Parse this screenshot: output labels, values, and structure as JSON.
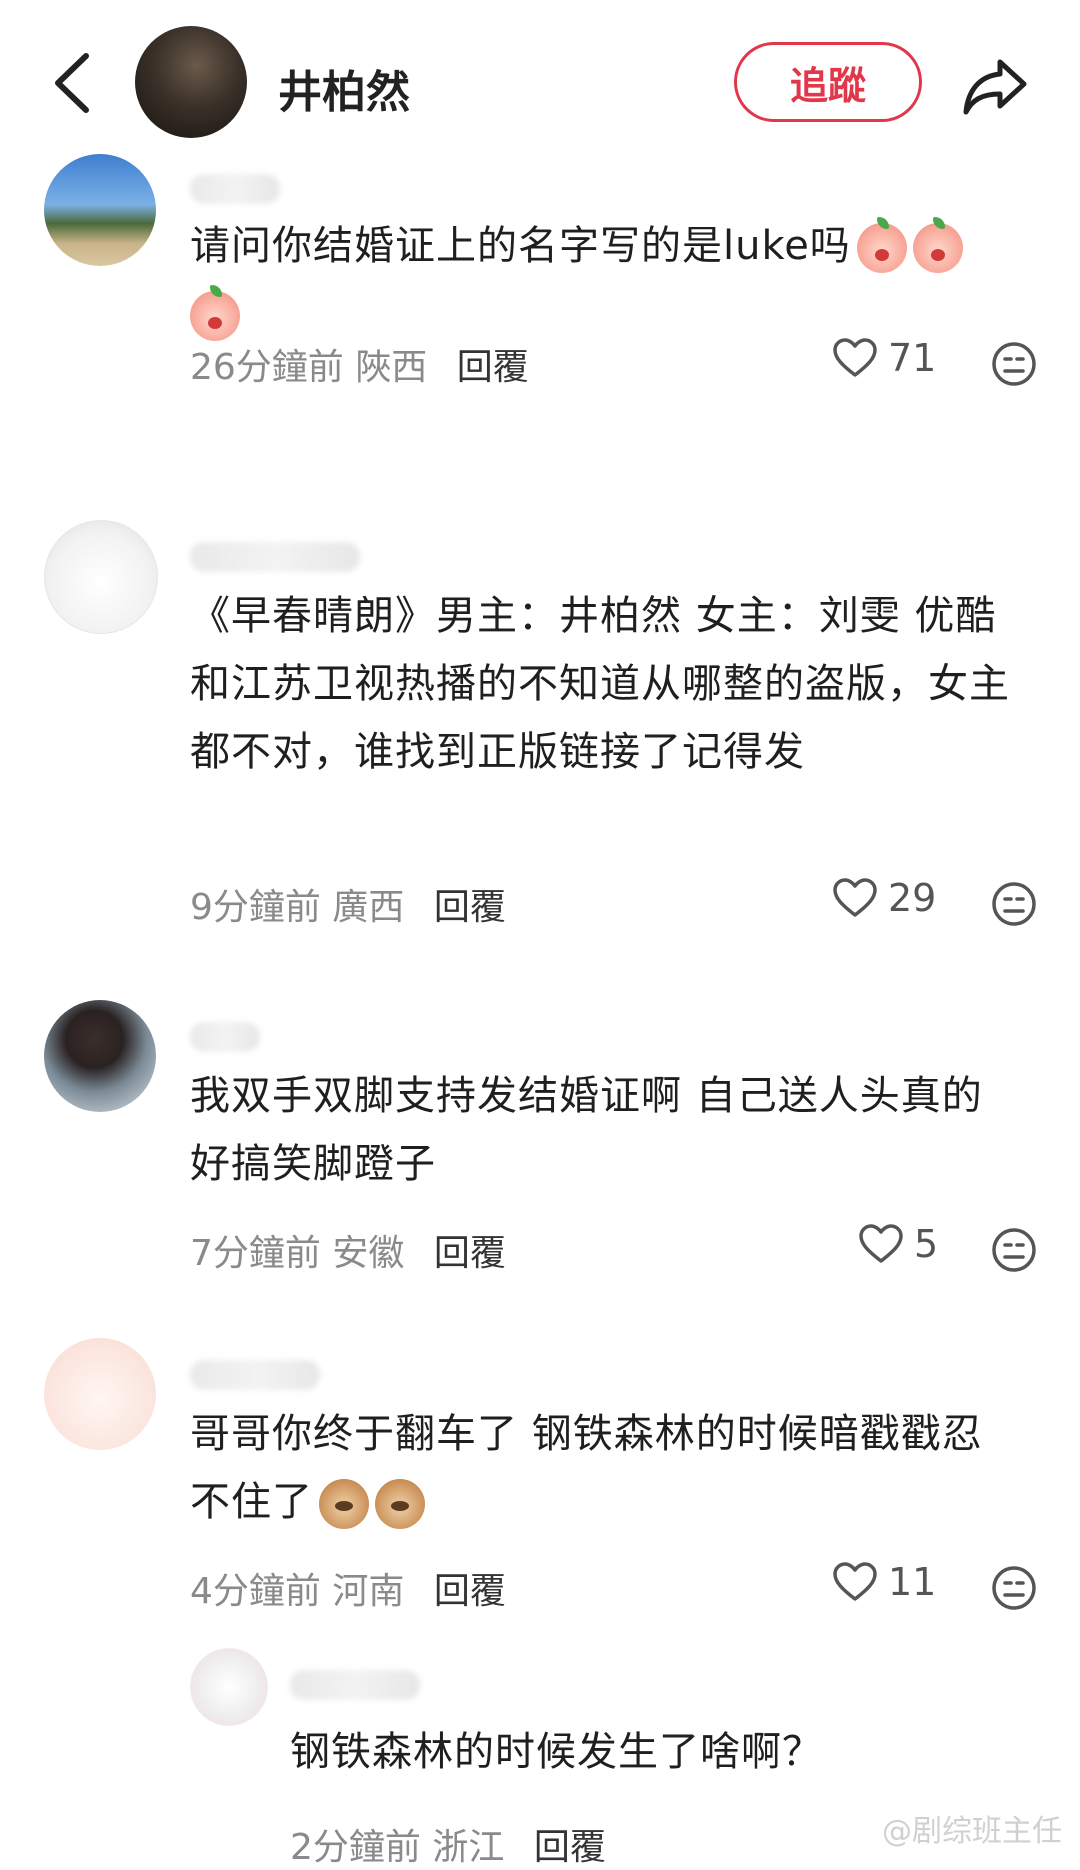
{
  "header": {
    "account_name": "井柏然",
    "follow_label": "追蹤"
  },
  "comments": [
    {
      "text": "请问你结婚证上的名字写的是luke吗",
      "emojis": [
        "peach",
        "peach",
        "peach"
      ],
      "time": "26分鐘前",
      "location": "陜西",
      "reply_label": "回覆",
      "likes": "71"
    },
    {
      "text": "《早春晴朗》男主：井柏然 女主：刘雯  优酷和江苏卫视热播的不知道从哪整的盗版，女主都不对，谁找到正版链接了记得发",
      "time": "9分鐘前",
      "location": "廣西",
      "reply_label": "回覆",
      "likes": "29"
    },
    {
      "text": "我双手双脚支持发结婚证啊 自己送人头真的好搞笑脚蹬子",
      "time": "7分鐘前",
      "location": "安徽",
      "reply_label": "回覆",
      "likes": "5"
    },
    {
      "text": "哥哥你终于翻车了 钢铁森林的时候暗戳戳忍不住了",
      "emojis": [
        "dog",
        "dog"
      ],
      "time": "4分鐘前",
      "location": "河南",
      "reply_label": "回覆",
      "likes": "11"
    }
  ],
  "reply": {
    "text": "钢铁森林的时候发生了啥啊？",
    "time": "2分鐘前",
    "location": "浙江",
    "reply_label": "回覆"
  },
  "watermark": "@剧综班主任",
  "colors": {
    "accent": "#e2364a",
    "meta": "#8a8a8a",
    "text": "#1f1f1f"
  }
}
